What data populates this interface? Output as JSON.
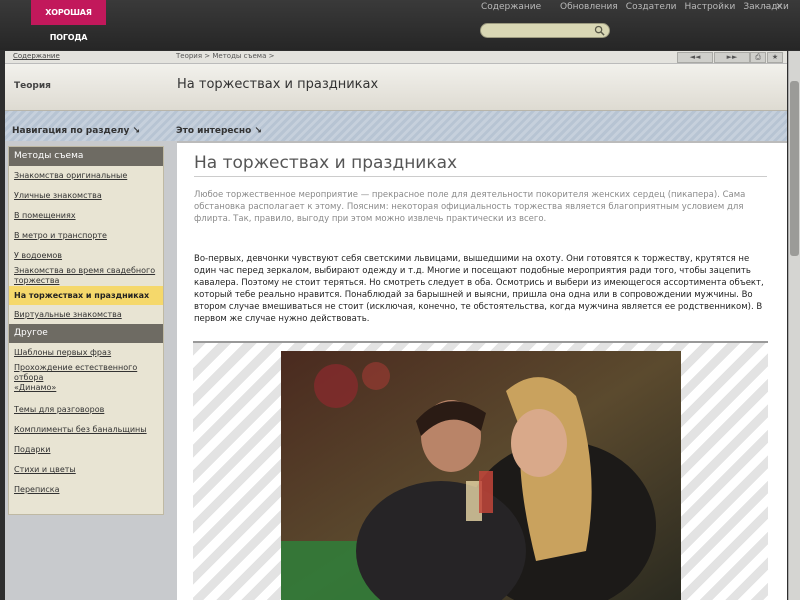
{
  "app": {
    "logo_text": "ХОРОШАЯ ПОГОДА",
    "contents_link": "Содержание",
    "nav": [
      "Обновления",
      "Создатели",
      "Настройки",
      "Закладки"
    ],
    "window_controls": [
      "–",
      "✕"
    ],
    "search": {
      "value": "",
      "placeholder": ""
    }
  },
  "breadcrumb": {
    "contents": "Содержание",
    "path": "Теория > Методы съема >"
  },
  "navbuttons": {
    "prev": "◄◄",
    "next": "►►",
    "print": "⎙",
    "bookmark": "★"
  },
  "header": {
    "section": "Теория",
    "title": "На торжествах и праздниках"
  },
  "sidebar": {
    "header": "Навигация по разделу",
    "groups": [
      {
        "title": "Методы съема",
        "items": [
          {
            "label": "Знакомства оригинальные"
          },
          {
            "label": "Уличные знакомства"
          },
          {
            "label": "В помещениях"
          },
          {
            "label": "В метро и транспорте"
          },
          {
            "label": "У водоемов"
          },
          {
            "label": "Знакомства во время свадебного торжества"
          },
          {
            "label": "На торжествах и праздниках",
            "active": true
          },
          {
            "label": "Виртуальные знакомства"
          }
        ]
      },
      {
        "title": "Другое",
        "items": [
          {
            "label": "Шаблоны первых фраз"
          },
          {
            "label": "Прохождение естественного отбора"
          },
          {
            "label": "«Динамо»"
          },
          {
            "label": "Темы для разговоров"
          },
          {
            "label": "Комплименты без банальщины"
          },
          {
            "label": "Подарки"
          },
          {
            "label": "Стихи и цветы"
          },
          {
            "label": "Переписка"
          }
        ]
      }
    ]
  },
  "content": {
    "header": "Это интересно",
    "article_title": "На торжествах и праздниках",
    "lead": "Любое торжественное мероприятие — прекрасное поле для деятельности покорителя женских сердец (пикапера). Сама обстановка располагает к этому. Поясним: некоторая официальность торжества является благоприятным условием для флирта. Так, правило, выгоду при этом можно извлечь практически из всего.",
    "body": "Во-первых, девчонки чувствуют себя светскими львицами, вышедшими на охоту. Они готовятся к торжеству, крутятся не один час перед зеркалом, выбирают одежду и т.д. Многие и посещают подобные мероприятия ради того, чтобы зацепить кавалера. Поэтому не стоит теряться. Но смотреть следует в оба. Осмотрись и выбери из имеющегося ассортимента объект, который тебе реально нравится. Понаблюдай за барышней и выясни, пришла она одна или в сопровождении мужчины. Во втором случае вмешиваться не стоит (исключая, конечно, те обстоятельства, когда мужчина является ее родственником). В первом же случае нужно действовать."
  }
}
